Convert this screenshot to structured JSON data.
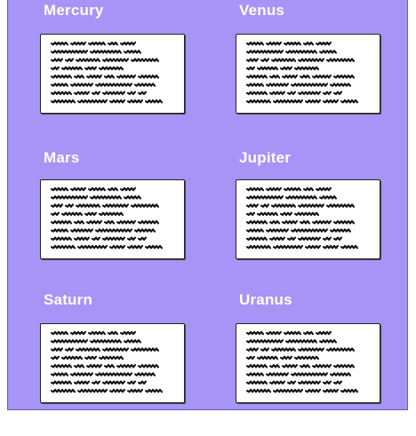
{
  "planets": [
    {
      "name": "Mercury"
    },
    {
      "name": "Venus"
    },
    {
      "name": "Mars"
    },
    {
      "name": "Jupiter"
    },
    {
      "name": "Saturn"
    },
    {
      "name": "Uranus"
    }
  ],
  "colors": {
    "background": "#a794f6",
    "title": "#ffffff",
    "card": "#ffffff",
    "scribble": "#111111"
  }
}
